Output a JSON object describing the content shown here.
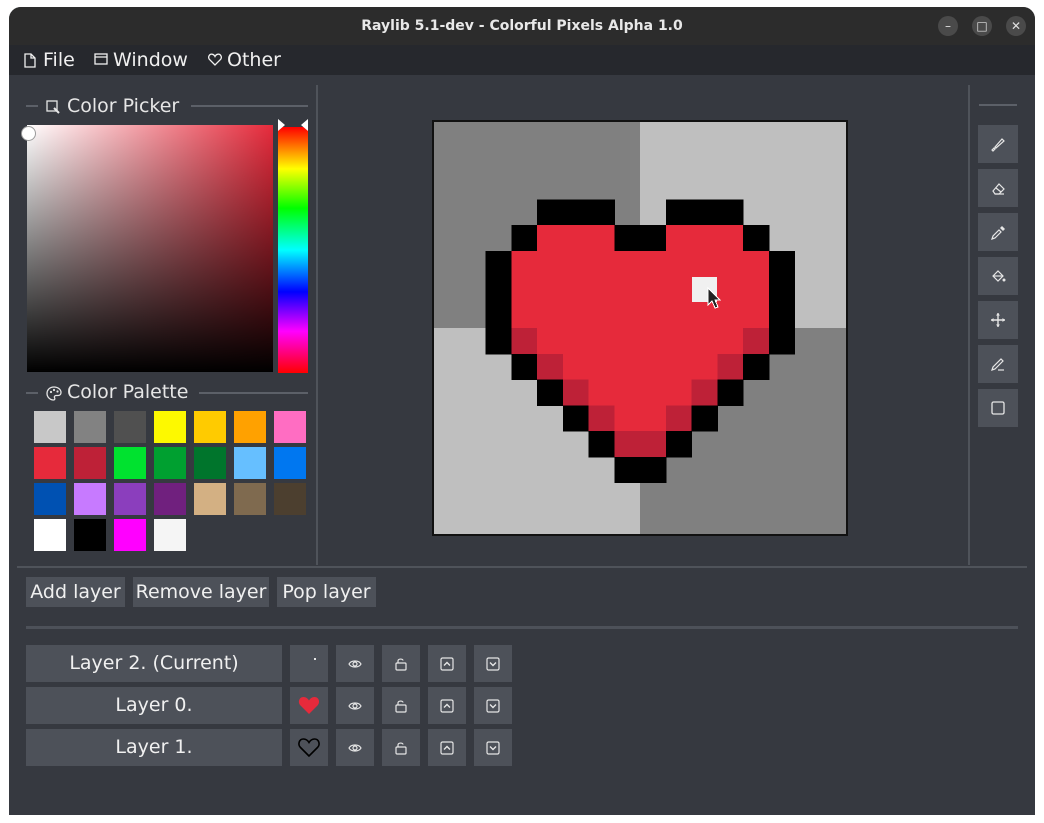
{
  "window": {
    "title": "Raylib 5.1-dev - Colorful Pixels Alpha 1.0",
    "controls": {
      "minimize": "–",
      "maximize": "□",
      "close": "✕"
    }
  },
  "menu": [
    {
      "label": "File",
      "icon": "file-icon"
    },
    {
      "label": "Window",
      "icon": "window-icon"
    },
    {
      "label": "Other",
      "icon": "heart-outline-icon"
    }
  ],
  "color_picker": {
    "title": "Color Picker",
    "selected_hue": "#e62a3b"
  },
  "color_palette": {
    "title": "Color Palette",
    "colors": [
      "#c8c8c8",
      "#828282",
      "#505050",
      "#fdf900",
      "#ffcb00",
      "#ffa100",
      "#ff6dc2",
      "#e62a3b",
      "#be2137",
      "#00e22f",
      "#00a030",
      "#00752c",
      "#66bfff",
      "#0077f0",
      "#0051b2",
      "#c77aff",
      "#8b3ebd",
      "#70207e",
      "#d3b083",
      "#7f6a4f",
      "#4c3f2f",
      "#ffffff",
      "#000000",
      "#ff00ff",
      "#f5f5f5"
    ]
  },
  "tools": [
    {
      "name": "brush-icon"
    },
    {
      "name": "eraser-icon"
    },
    {
      "name": "eyedropper-icon"
    },
    {
      "name": "fill-bucket-icon"
    },
    {
      "name": "move-icon"
    },
    {
      "name": "pencil-icon"
    },
    {
      "name": "rectangle-icon"
    }
  ],
  "layer_actions": {
    "add": "Add layer",
    "remove": "Remove layer",
    "pop": "Pop layer"
  },
  "layers": [
    {
      "label": "Layer 2. (Current)",
      "thumbnail": "dot"
    },
    {
      "label": "Layer 0.",
      "thumbnail": "heart-filled"
    },
    {
      "label": "Layer 1.",
      "thumbnail": "heart-outline"
    }
  ],
  "colors": {
    "heart_red": "#e62a3b",
    "heart_shade": "#be2137",
    "outline": "#000000",
    "bg_dark": "#808080",
    "bg_light": "#bfbfbf"
  }
}
